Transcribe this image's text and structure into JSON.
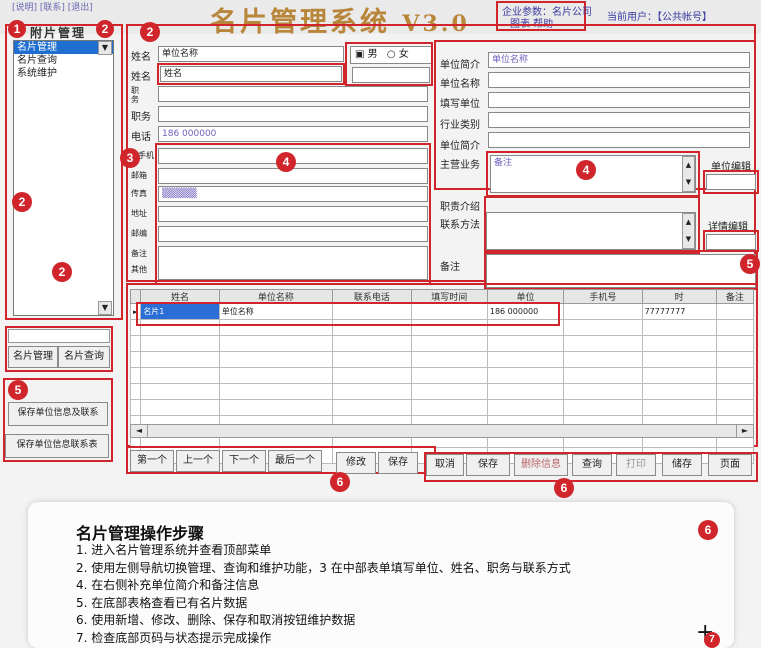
{
  "header": {
    "title": "名片管理系统",
    "version": "V3.0",
    "top_links": "[说明] [联系] [退出]",
    "meta_line1": "企业参数：名片公司",
    "meta_line2": "图表 帮助",
    "user_label": "当前用户：【公共帐号】"
  },
  "sidebar": {
    "heading": "附片管理",
    "items": [
      {
        "label": "名片管理"
      },
      {
        "label": "名片查询"
      },
      {
        "label": "系统维护"
      }
    ],
    "tab_manage": "名片管理",
    "tab_query": "名片查询",
    "action_save": "保存单位信息及联系",
    "action_record": "保存单位信息联系表"
  },
  "form": {
    "name_label": "姓名",
    "name_value": "单位名称",
    "name2_label": "姓名",
    "name2_value": "姓名",
    "gender_male": "男",
    "gender_female": "女",
    "duty_label": "职务",
    "phone_label": "电话",
    "phone_value": "186 000000",
    "mobile_label": "手机",
    "email_label": "邮箱",
    "fax_label": "传真",
    "addr_label": "地址",
    "zip_label": "邮编",
    "remark_label": "备注",
    "extra_label": "其他"
  },
  "right_form": {
    "unit_intro_label": "单位简介",
    "unit_intro_value": "单位名称",
    "unit_name_label": "单位名称",
    "fill_unit_label": "填写单位",
    "industry_label": "行业类别",
    "unit_brief_label": "单位简介",
    "main_business_label": "主营业务",
    "main_business_value": "备注",
    "unit_edit_button": "单位编辑",
    "contact_label": "职责介绍",
    "contact_method_label": "联系方法",
    "detail_edit_button": "详情编辑",
    "note_label": "备注"
  },
  "table": {
    "columns": [
      "姓名",
      "单位名称",
      "联系电话",
      "填写时间",
      "单位",
      "手机号",
      "时",
      "备注"
    ],
    "rows": [
      [
        "名片1",
        "单位名称",
        "",
        "",
        "186 000000",
        "",
        "77777777",
        ""
      ]
    ],
    "empty_rows": 9
  },
  "toolbar": {
    "first": "第一个",
    "prev": "上一个",
    "next": "下一个",
    "last": "最后一个",
    "modify": "修改",
    "save": "保存",
    "cancel": "取消",
    "keep": "保存",
    "delete_info": "删除信息",
    "query": "查询",
    "print": "打印",
    "store": "储存",
    "page": "页面"
  },
  "steps": {
    "title": "名片管理操作步骤",
    "lines": [
      "1. 进入名片管理系统并查看顶部菜单",
      "2. 使用左侧导航切换管理、查询和维护功能，3 在中部表单填写单位、姓名、职务与联系方式",
      "4. 在右侧补充单位简介和备注信息",
      "5. 在底部表格查看已有名片数据",
      "6. 使用新增、修改、删除、保存和取消按钮维护数据",
      "7. 检查底部页码与状态提示完成操作"
    ]
  },
  "badges": [
    "1",
    "2",
    "2",
    "2",
    "2",
    "2",
    "3",
    "4",
    "4",
    "5",
    "5",
    "6",
    "6",
    "6",
    "6",
    "7"
  ]
}
